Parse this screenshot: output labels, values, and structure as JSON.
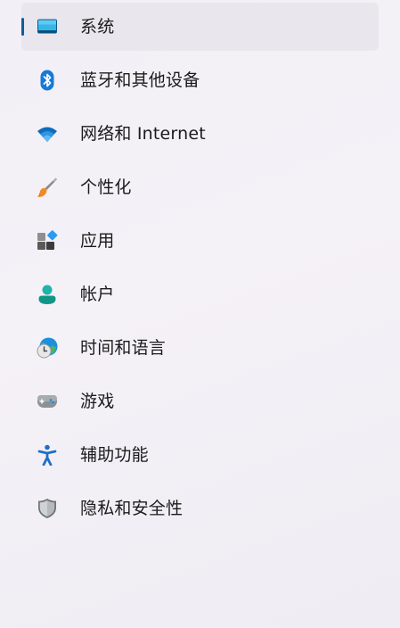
{
  "nav": {
    "selected_index": 0,
    "accent_color": "#0f5c9e",
    "items": [
      {
        "label": "系统",
        "icon": "system-display-icon"
      },
      {
        "label": "蓝牙和其他设备",
        "icon": "bluetooth-icon"
      },
      {
        "label": "网络和 Internet",
        "icon": "wifi-icon"
      },
      {
        "label": "个性化",
        "icon": "paintbrush-icon"
      },
      {
        "label": "应用",
        "icon": "apps-icon"
      },
      {
        "label": "帐户",
        "icon": "account-icon"
      },
      {
        "label": "时间和语言",
        "icon": "time-language-icon"
      },
      {
        "label": "游戏",
        "icon": "gamepad-icon"
      },
      {
        "label": "辅助功能",
        "icon": "accessibility-icon"
      },
      {
        "label": "隐私和安全性",
        "icon": "shield-icon"
      }
    ]
  }
}
